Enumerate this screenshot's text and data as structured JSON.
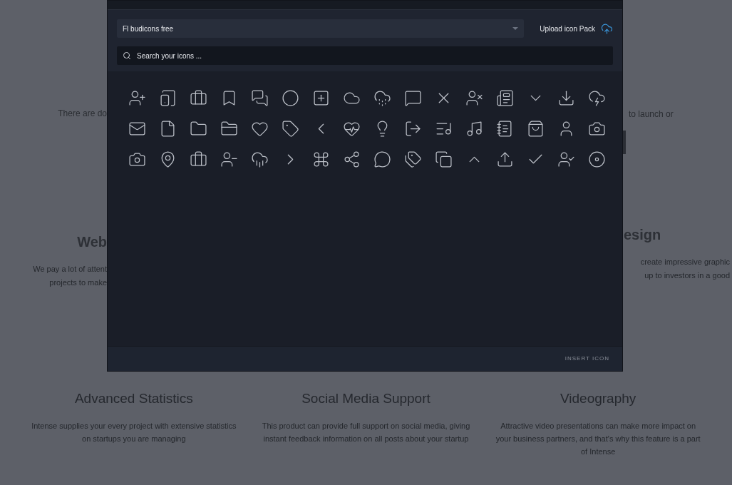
{
  "background": {
    "left": {
      "intro": "There are do",
      "heading": "Web",
      "lines": [
        "We pay a lot of attent",
        "projects to make"
      ]
    },
    "right": {
      "intro": "to launch or",
      "heading": "esign",
      "lines": [
        "create impressive graphic",
        "up to investors in a good"
      ]
    },
    "features": [
      {
        "title": "Advanced Statistics",
        "description": "Intense supplies your every project with extensive statistics on startups you are managing"
      },
      {
        "title": "Social Media Support",
        "description": "This product can provide full support on social media, giving instant feedback information on all posts about your startup"
      },
      {
        "title": "Videography",
        "description": "Attractive video presentations can make more impact on your business partners, and that's why this feature is a part of Intense"
      }
    ]
  },
  "modal": {
    "icon_pack": {
      "value": "Fl budicons free"
    },
    "upload_button": "Upload icon Pack",
    "search": {
      "placeholder": "Search your icons ..."
    },
    "insert_button": "INSERT ICON"
  }
}
